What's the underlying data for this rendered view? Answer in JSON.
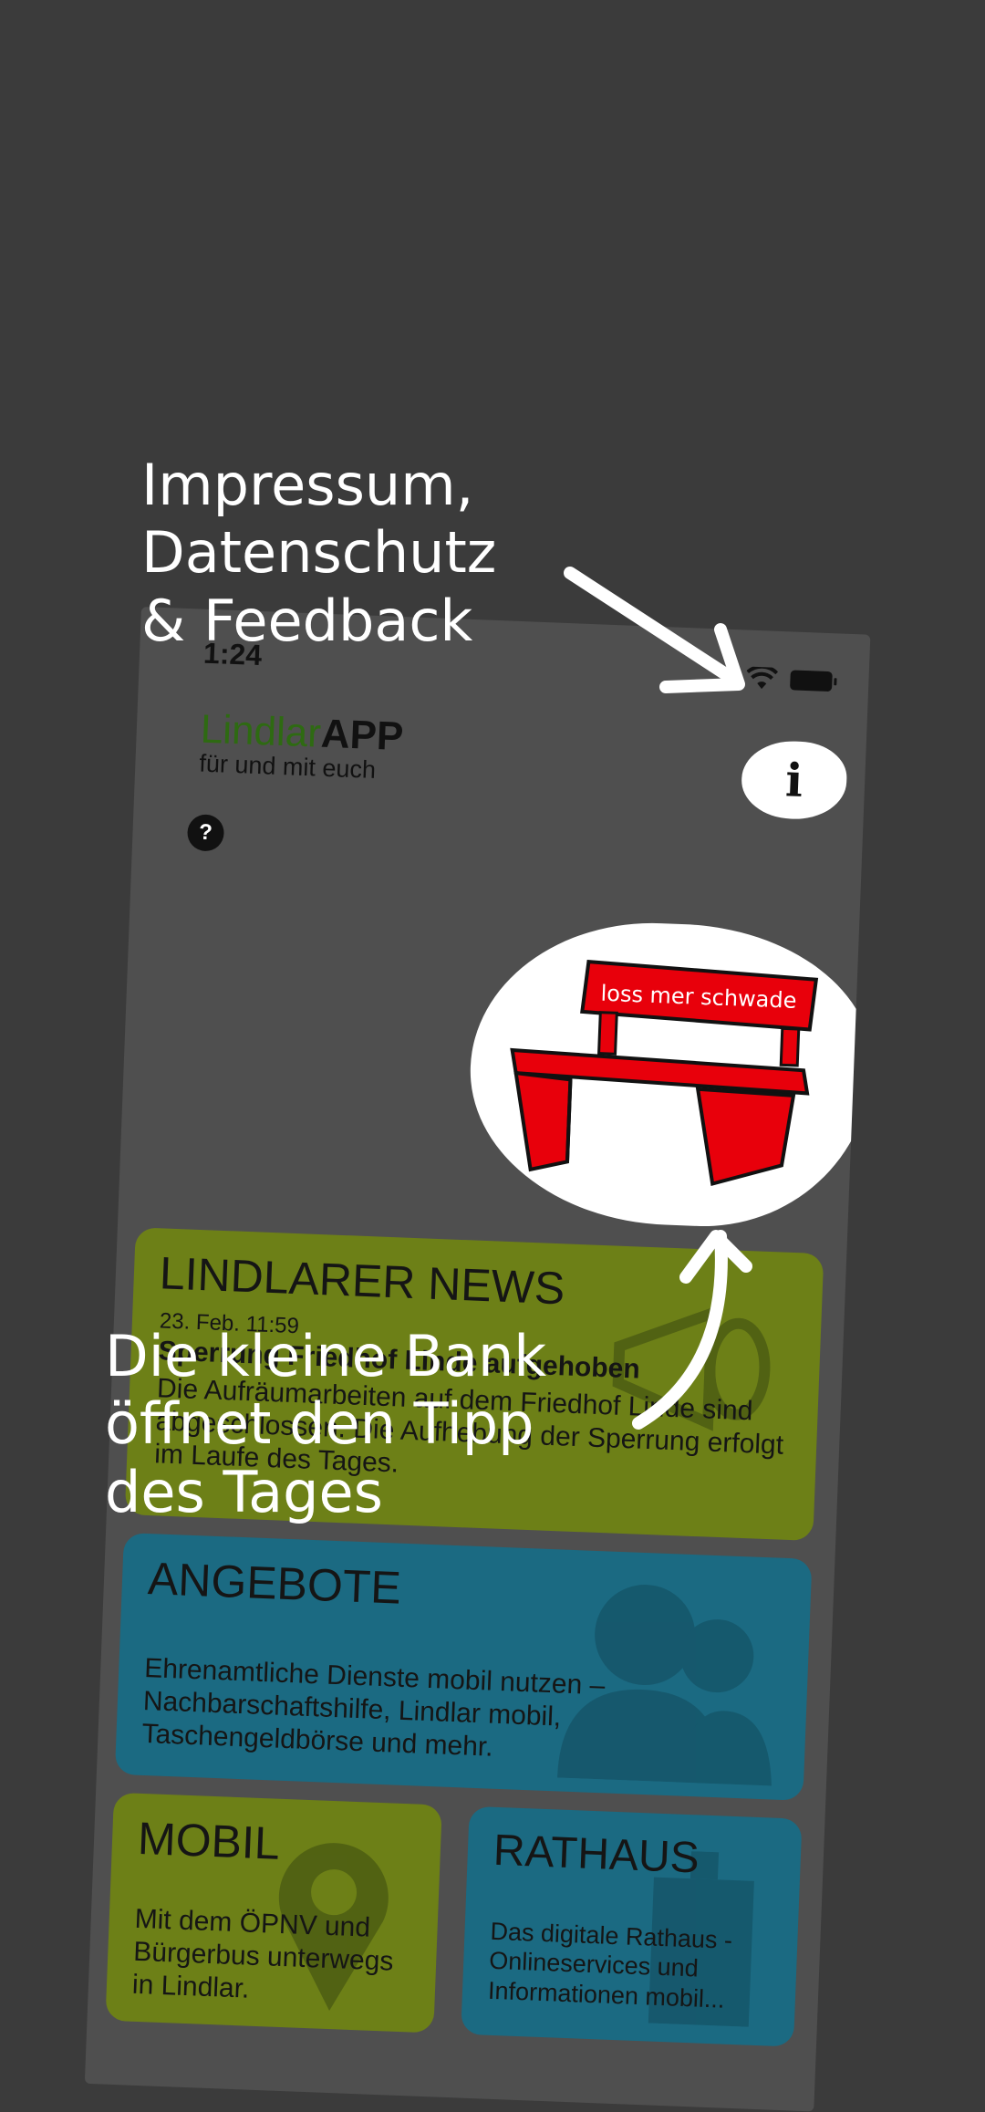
{
  "status": {
    "time": "1:24"
  },
  "logo": {
    "part1": "Lindlar",
    "part2": "APP",
    "tagline": "für und mit euch"
  },
  "info_button": {
    "label": "i"
  },
  "help_button": {
    "label": "?"
  },
  "bench": {
    "sign_text": "loss mer schwade"
  },
  "tiles": {
    "news": {
      "title": "LINDLARER NEWS",
      "date": "23. Feb. 11:59",
      "headline": "Sperrung Friedhof Linde aufgehoben",
      "body": "Die Aufräumarbeiten auf dem Friedhof Linde sind abgeschlossen. Die Aufhebung der Sperrung erfolgt im Laufe des Tages."
    },
    "angebote": {
      "title": "ANGEBOTE",
      "body": "Ehrenamtliche Dienste mobil nutzen – Nachbarschaftshilfe, Lindlar mobil, Taschengeldbörse und mehr."
    },
    "mobil": {
      "title": "MOBIL",
      "body": "Mit dem ÖPNV und Bürgerbus unterwegs in Lindlar."
    },
    "rathaus": {
      "title": "RATHAUS",
      "body": "Das digitale Rathaus - Onlineservices und Informationen mobil..."
    }
  },
  "annotations": {
    "top": [
      "Impressum,",
      "Datenschutz",
      "& Feedback"
    ],
    "bottom": [
      "Die kleine Bank",
      "öffnet den Tipp",
      "des Tages"
    ]
  },
  "colors": {
    "background": "#3b3b3b",
    "screen": "#4f4f4f",
    "green_tile": "#6d8017",
    "blue_tile": "#1b6a82",
    "bench_red": "#e8000b",
    "logo_green": "#2e6a12"
  },
  "icons": [
    "wifi-icon",
    "battery-icon",
    "info-icon",
    "help-icon",
    "megaphone-icon",
    "people-icon",
    "map-pin-icon",
    "building-icon",
    "bench-icon"
  ]
}
